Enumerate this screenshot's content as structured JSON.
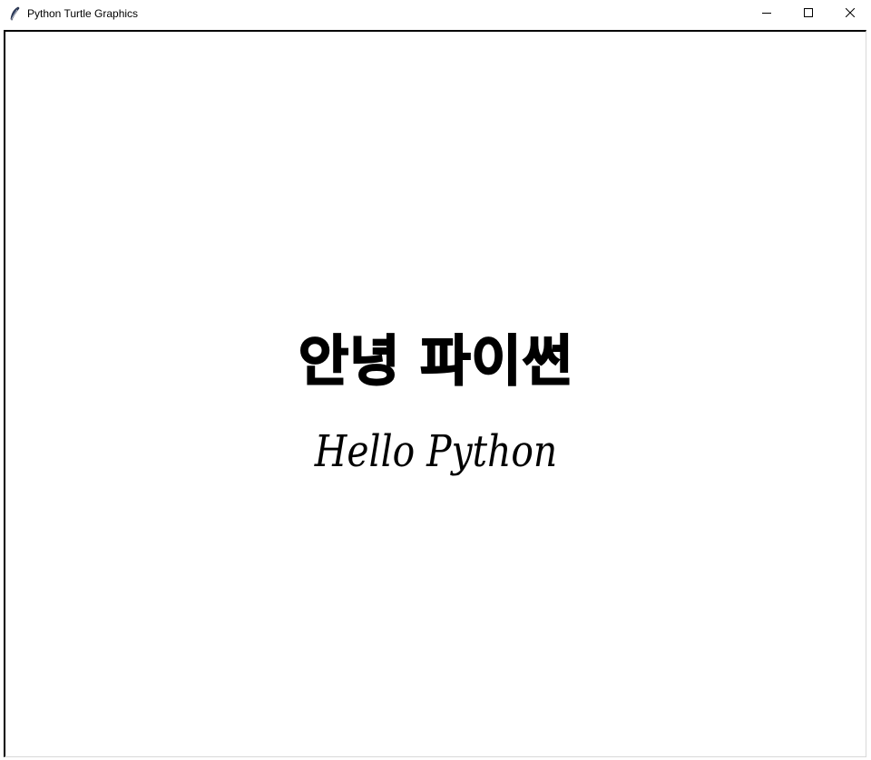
{
  "window": {
    "title": "Python Turtle Graphics",
    "icon": "feather-icon",
    "controls": {
      "minimize_icon": "minimize-icon",
      "maximize_icon": "maximize-icon",
      "close_icon": "close-icon"
    }
  },
  "canvas": {
    "background": "#ffffff",
    "texts": {
      "korean": "안녕 파이썬",
      "english": "Hello Python"
    },
    "text_color": "#000000"
  }
}
